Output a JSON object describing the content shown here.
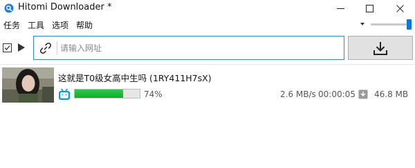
{
  "window": {
    "title": "Hitomi Downloader *",
    "accent": "#0a76d6"
  },
  "menu": [
    "任务",
    "工具",
    "选项",
    "帮助"
  ],
  "toolbar": {
    "url_placeholder": "请输入网址",
    "url_value": "",
    "select_all_checked": false
  },
  "zoom": {
    "level_fraction": 1.0
  },
  "tasks": [
    {
      "title": "这就是T0级女高中生吗 (1RY411H7sX)",
      "site": "bilibili",
      "progress_percent": 74,
      "progress_text": "74%",
      "speed": "2.6 MB/s",
      "eta": "00:00:05",
      "size": "46.8 MB",
      "progress_color": "#06b025"
    }
  ]
}
